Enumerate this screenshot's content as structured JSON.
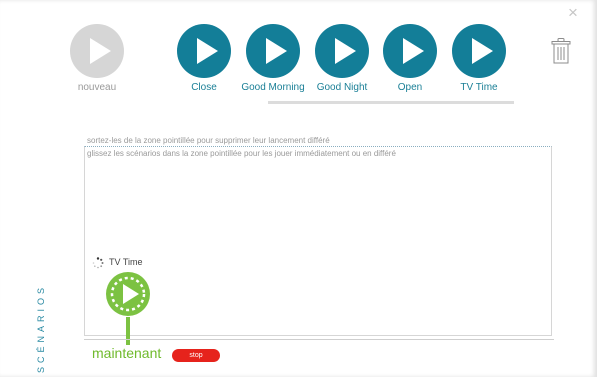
{
  "window": {
    "close_glyph": "×"
  },
  "scenarios": [
    {
      "label": "nouveau",
      "style": "grey",
      "icon": "play-icon"
    },
    {
      "label": "Close",
      "style": "teal",
      "icon": "play-icon"
    },
    {
      "label": "Good Morning",
      "style": "teal",
      "icon": "play-icon"
    },
    {
      "label": "Good Night",
      "style": "teal",
      "icon": "play-icon"
    },
    {
      "label": "Open",
      "style": "teal",
      "icon": "play-icon"
    },
    {
      "label": "TV Time",
      "style": "teal",
      "icon": "play-icon"
    }
  ],
  "trash": {
    "icon": "trash-icon"
  },
  "zone": {
    "hint_top": "sortez-les de la zone pointillée pour supprimer leur lancement différé",
    "hint_inner": "glissez les scénarios dans la zone pointillée pour les jouer immédiatement ou en différé"
  },
  "running": {
    "label": "TV Time",
    "icon": "spinner-icon",
    "button_icon": "play-icon"
  },
  "timeline": {
    "now_label": "maintenant",
    "stop_label": "stop"
  },
  "side_label": "SCÉNARIOS",
  "colors": {
    "teal": "#137e98",
    "grey": "#d6d6d6",
    "green": "#7cc242",
    "red": "#e6231c"
  }
}
